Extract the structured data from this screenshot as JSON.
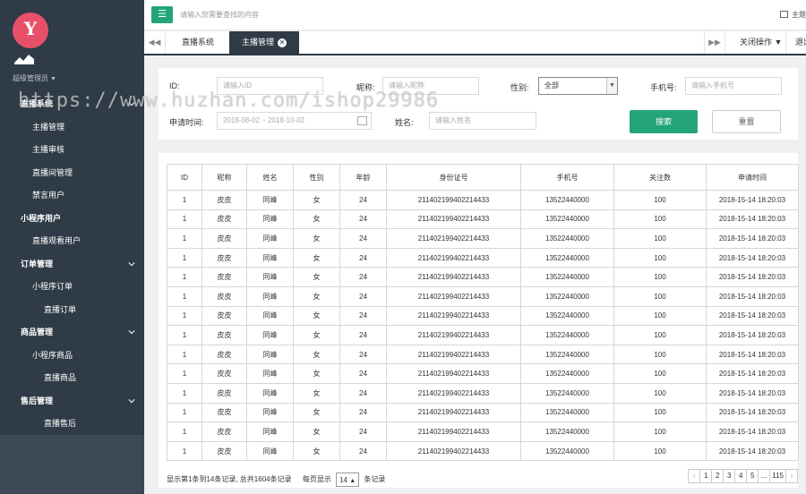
{
  "sidebar": {
    "admin_label": "超级管理员",
    "items": [
      {
        "label": "直播系统",
        "level": "group",
        "expandable": true
      },
      {
        "label": "主播管理",
        "level": "l2"
      },
      {
        "label": "主播审核",
        "level": "l2"
      },
      {
        "label": "直播间管理",
        "level": "l2"
      },
      {
        "label": "禁言用户",
        "level": "l2"
      },
      {
        "label": "小程序用户",
        "level": "group",
        "expandable": false
      },
      {
        "label": "直播观看用户",
        "level": "l2"
      },
      {
        "label": "订单管理",
        "level": "group",
        "expandable": true
      },
      {
        "label": "小程序订单",
        "level": "l2"
      },
      {
        "label": "直播订单",
        "level": "l3"
      },
      {
        "label": "商品管理",
        "level": "group",
        "expandable": true
      },
      {
        "label": "小程序商品",
        "level": "l2"
      },
      {
        "label": "直播商品",
        "level": "l3"
      },
      {
        "label": "售后管理",
        "level": "group",
        "expandable": true
      },
      {
        "label": "直播售后",
        "level": "l3"
      }
    ]
  },
  "topbar": {
    "menu_icon": "menu-icon",
    "search_placeholder": "请输入您需要查找的内容",
    "right_label": "主题"
  },
  "tabs": {
    "prev_icon": "◀◀",
    "items": [
      {
        "label": "直播系统",
        "active": false
      },
      {
        "label": "主播管理",
        "active": true
      }
    ],
    "next_icon": "▶▶",
    "close_ops": "关闭操作",
    "exit": "退出"
  },
  "filter": {
    "id_label": "ID:",
    "id_placeholder": "请输入ID",
    "nickname_label": "昵称:",
    "nickname_placeholder": "请输入昵称",
    "gender_label": "性别:",
    "gender_value": "全部",
    "phone_label": "手机号:",
    "phone_placeholder": "请输入手机号",
    "apply_time_label": "申请时间:",
    "apply_time_value": "2018-08-02 ~ 2018-10-02",
    "name_label": "姓名:",
    "name_placeholder": "请输入姓名",
    "search_button": "搜索",
    "reset_button": "重置"
  },
  "table": {
    "columns": [
      "ID",
      "昵称",
      "姓名",
      "性别",
      "年龄",
      "身份证号",
      "手机号",
      "关注数",
      "申请时间"
    ],
    "rows": [
      [
        "1",
        "皮皮",
        "同峰",
        "女",
        "24",
        "211402199402214433",
        "13522440000",
        "100",
        "2018-15-14  18:20:03"
      ],
      [
        "1",
        "皮皮",
        "同峰",
        "女",
        "24",
        "211402199402214433",
        "13522440000",
        "100",
        "2018-15-14  18:20:03"
      ],
      [
        "1",
        "皮皮",
        "同峰",
        "女",
        "24",
        "211402199402214433",
        "13522440000",
        "100",
        "2018-15-14  18:20:03"
      ],
      [
        "1",
        "皮皮",
        "同峰",
        "女",
        "24",
        "211402199402214433",
        "13522440000",
        "100",
        "2018-15-14  18:20:03"
      ],
      [
        "1",
        "皮皮",
        "同峰",
        "女",
        "24",
        "211402199402214433",
        "13522440000",
        "100",
        "2018-15-14  18:20:03"
      ],
      [
        "1",
        "皮皮",
        "同峰",
        "女",
        "24",
        "211402199402214433",
        "13522440000",
        "100",
        "2018-15-14  18:20:03"
      ],
      [
        "1",
        "皮皮",
        "同峰",
        "女",
        "24",
        "211402199402214433",
        "13522440000",
        "100",
        "2018-15-14  18:20:03"
      ],
      [
        "1",
        "皮皮",
        "同峰",
        "女",
        "24",
        "211402199402214433",
        "13522440000",
        "100",
        "2018-15-14  18:20:03"
      ],
      [
        "1",
        "皮皮",
        "同峰",
        "女",
        "24",
        "211402199402214433",
        "13522440000",
        "100",
        "2018-15-14  18:20:03"
      ],
      [
        "1",
        "皮皮",
        "同峰",
        "女",
        "24",
        "211402199402214433",
        "13522440000",
        "100",
        "2018-15-14  18:20:03"
      ],
      [
        "1",
        "皮皮",
        "同峰",
        "女",
        "24",
        "211402199402214433",
        "13522440000",
        "100",
        "2018-15-14  18:20:03"
      ],
      [
        "1",
        "皮皮",
        "同峰",
        "女",
        "24",
        "211402199402214433",
        "13522440000",
        "100",
        "2018-15-14  18:20:03"
      ],
      [
        "1",
        "皮皮",
        "同峰",
        "女",
        "24",
        "211402199402214433",
        "13522440000",
        "100",
        "2018-15-14  18:20:03"
      ],
      [
        "1",
        "皮皮",
        "同峰",
        "女",
        "24",
        "211402199402214433",
        "13522440000",
        "100",
        "2018-15-14  18:20:03"
      ]
    ]
  },
  "footer": {
    "summary": "显示第1条到14条记录, 总共1604条记录",
    "per_page_label": "每页显示",
    "per_page_value": "14",
    "records_label": "条记录",
    "pages": [
      "‹",
      "1",
      "2",
      "3",
      "4",
      "5",
      "...",
      "115",
      "›"
    ],
    "current_page": "1"
  },
  "watermark": "https://www.huzhan.com/ishop29986",
  "colors": {
    "sidebar_bg": "#2f3b47",
    "accent_green": "#23a47a",
    "logo_pink": "#e8506a"
  }
}
